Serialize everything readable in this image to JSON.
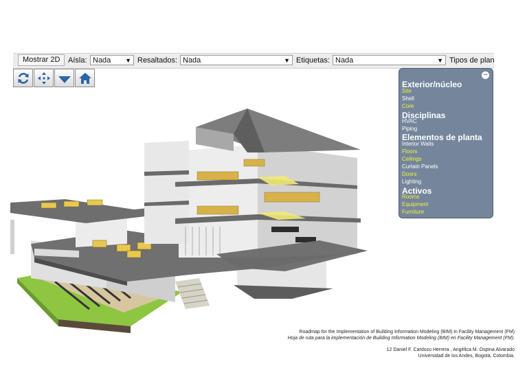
{
  "toolbar": {
    "btn_2d": "Mostrar 2D",
    "aisla_label": "Aísla:",
    "aisla_value": "Nada",
    "resaltados_label": "Resaltados:",
    "resaltados_value": "Nada",
    "etiquetas_label": "Etiquetas:",
    "etiquetas_value": "Nada",
    "tipos_label": "Tipos de plan"
  },
  "nav": [
    "refresh-icon",
    "pan-icon",
    "down-arrow-icon",
    "home-icon"
  ],
  "panel": {
    "minus": "−",
    "sections": [
      {
        "title": "Exterior/núcleo",
        "items": [
          {
            "label": "Site",
            "color": "yellow"
          },
          {
            "label": "Shell",
            "color": "white"
          },
          {
            "label": "Core",
            "color": "yellow"
          }
        ]
      },
      {
        "title": "Disciplinas",
        "items": [
          {
            "label": "HVAC",
            "color": "white"
          },
          {
            "label": "Piping",
            "color": "white"
          }
        ]
      },
      {
        "title": "Elementos de planta",
        "items": [
          {
            "label": "Interior Walls",
            "color": "white"
          },
          {
            "label": "Floors",
            "color": "yellow"
          },
          {
            "label": "Ceilings",
            "color": "yellow"
          },
          {
            "label": "Curtain Panels",
            "color": "white"
          },
          {
            "label": "Doors",
            "color": "yellow"
          },
          {
            "label": "Lighting",
            "color": "white"
          }
        ]
      },
      {
        "title": "Activos",
        "items": [
          {
            "label": "Rooms",
            "color": "yellow"
          },
          {
            "label": "Equipment",
            "color": "yellow"
          },
          {
            "label": "Furniture",
            "color": "yellow"
          }
        ]
      }
    ]
  },
  "credits": {
    "line1": "Roadmap for the Implementation of Building Information Modeling (BIM) in Facility Management (FM)",
    "line2": "Hoja de ruta para la implementación de Building Information Modeling (BIM) en Facility Management (FM).",
    "line3": "12 Daniel F. Cardozo Herrera , Angélica M. Ospina Alvarado",
    "line4": "Universidad de los Andes, Bogotá, Colombia."
  }
}
